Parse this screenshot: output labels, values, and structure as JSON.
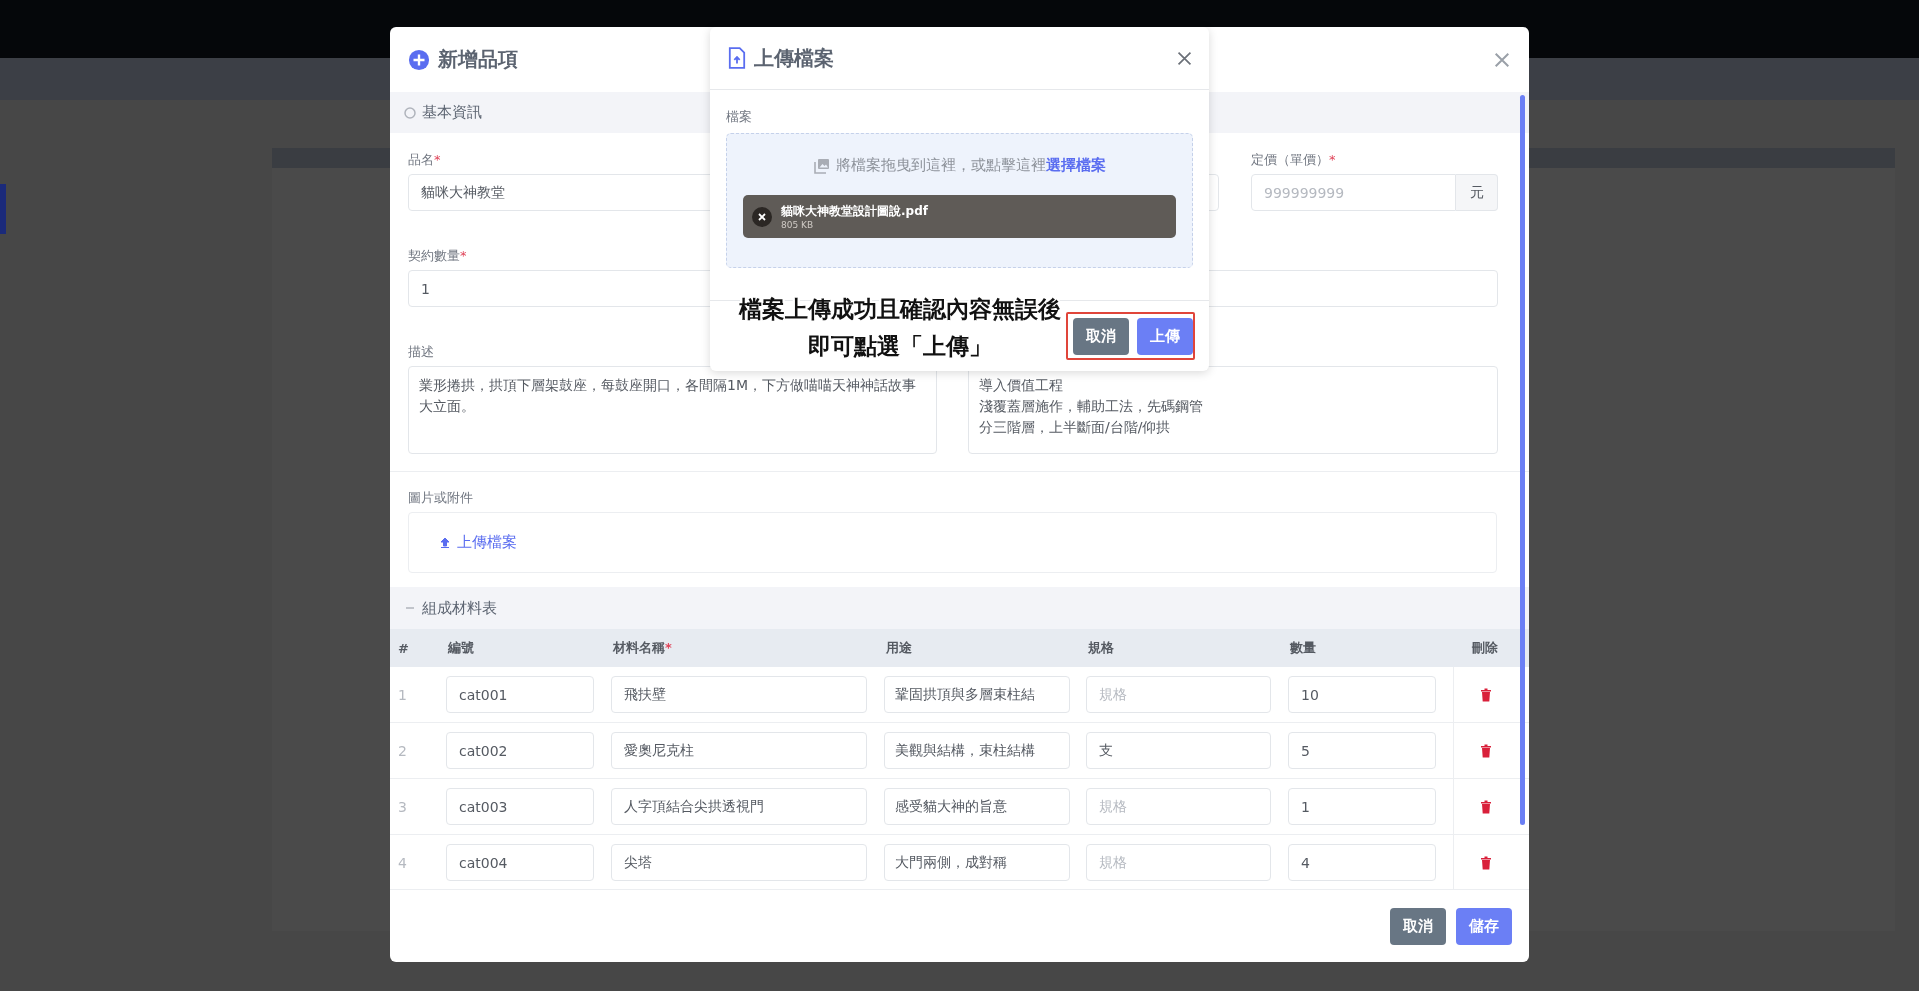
{
  "item_dialog": {
    "title": "新增品項",
    "basic_section": {
      "title": "基本資訊"
    },
    "name_field": {
      "label": "品名",
      "required_mark": "*",
      "value": "貓咪大神教堂"
    },
    "price_field": {
      "label": "定價（單價）",
      "required_mark": "*",
      "placeholder": "999999999",
      "unit": "元"
    },
    "quantity_field": {
      "label": "契約數量",
      "required_mark": "*",
      "value": "1"
    },
    "description_field": {
      "label": "描述",
      "value": "業形捲拱，拱頂下層架鼓座，每鼓座開口，各間隔1M，下方做喵喵天神神話故事大立面。"
    },
    "notes_field": {
      "lines": [
        "導入價值工程",
        "淺覆蓋層施作，輔助工法，先碼鋼管",
        "分三階層，上半斷面/台階/仰拱"
      ]
    },
    "attachments": {
      "label": "圖片或附件",
      "link": "上傳檔案"
    },
    "materials_section": {
      "title": "組成材料表",
      "columns": [
        {
          "label": "#"
        },
        {
          "label": "編號"
        },
        {
          "label": "材料名稱",
          "required_mark": "*"
        },
        {
          "label": "用途"
        },
        {
          "label": "規格"
        },
        {
          "label": "數量"
        },
        {
          "label": "刪除"
        }
      ],
      "rows": [
        {
          "index": "1",
          "code": "cat001",
          "name": "飛扶壁",
          "usage": "鞏固拱頂與多層束柱結",
          "spec": {
            "placeholder": "規格"
          },
          "quantity": "10"
        },
        {
          "index": "2",
          "code": "cat002",
          "name": "愛奧尼克柱",
          "usage": "美觀與結構，束柱結構",
          "spec": {
            "value": "支"
          },
          "quantity": "5"
        },
        {
          "index": "3",
          "code": "cat003",
          "name": "人字頂結合尖拱透視門",
          "usage": "感受貓大神的旨意",
          "spec": {
            "placeholder": "規格"
          },
          "quantity": "1"
        },
        {
          "index": "4",
          "code": "cat004",
          "name": "尖塔",
          "usage": "大門兩側，成對稱",
          "spec": {
            "placeholder": "規格"
          },
          "quantity": "4"
        }
      ]
    },
    "buttons": [
      {
        "label": "取消",
        "kind": "secondary"
      },
      {
        "label": "儲存",
        "kind": "primary"
      }
    ]
  },
  "upload_dialog": {
    "title": "上傳檔案",
    "field_label": "檔案",
    "drop_hint": "將檔案拖曳到這裡，或點擊這裡",
    "drop_link": "選擇檔案",
    "files": [
      {
        "name": "貓咪大神教堂設計圖說.pdf",
        "size": "805 KB"
      }
    ],
    "buttons": [
      {
        "label": "取消",
        "kind": "secondary"
      },
      {
        "label": "上傳",
        "kind": "primary"
      }
    ]
  },
  "annotation": {
    "lines": [
      "檔案上傳成功且確認內容無誤後",
      "即可點選「上傳」"
    ]
  }
}
